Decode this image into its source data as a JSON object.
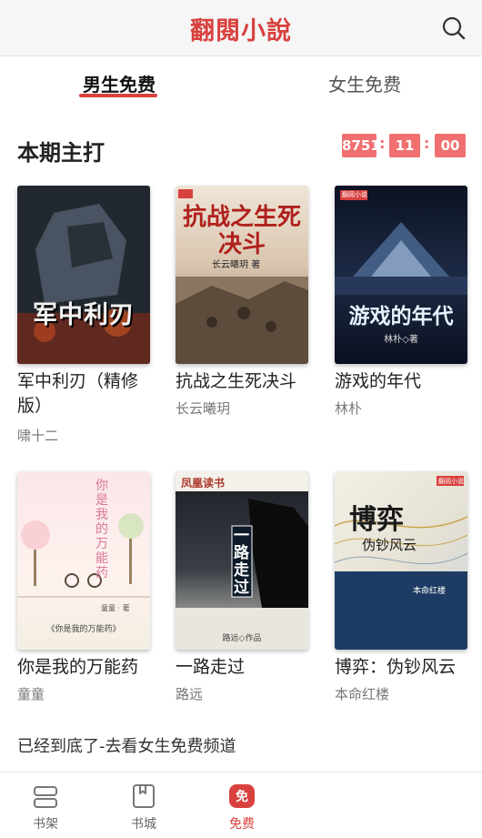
{
  "header": {
    "title": "翻閱小說",
    "search_icon": "search-icon"
  },
  "tabs": [
    {
      "label": "男生免费",
      "active": true
    },
    {
      "label": "女生免费",
      "active": false
    }
  ],
  "section": {
    "title": "本期主打",
    "countdown": {
      "hours": "8751",
      "minutes": "11",
      "seconds": "00"
    }
  },
  "books": [
    {
      "title": "军中利刃（精修版）",
      "author": "啸十二",
      "cover_text": "军中利刃"
    },
    {
      "title": "抗战之生死决斗",
      "author": "长云曦玥",
      "cover_text": "抗战之生死决斗",
      "cover_author": "长云曦玥 著"
    },
    {
      "title": "游戏的年代",
      "author": "林朴",
      "cover_text": "游戏的年代",
      "cover_author": "林朴◇著",
      "cover_brand": "翻阅小说"
    },
    {
      "title": "你是我的万能药",
      "author": "童童",
      "cover_text": "你是我的万能药",
      "cover_author": "童童 · 著",
      "cover_subtitle": "《你是我的万能药》"
    },
    {
      "title": "一路走过",
      "author": "路远",
      "cover_text": "一路走过",
      "cover_author": "路远◇作品",
      "cover_brand": "凤凰读书"
    },
    {
      "title": "博弈：伪钞风云",
      "author": "本命红楼",
      "cover_text": "博弈",
      "cover_subtitle": "伪钞风云",
      "cover_author": "本命红楼",
      "cover_brand": "翻阅小说"
    }
  ],
  "bottom_note": "已经到底了-去看女生免费频道",
  "tabbar": [
    {
      "label": "书架",
      "icon": "bookshelf-icon",
      "active": false
    },
    {
      "label": "书城",
      "icon": "bookstore-icon",
      "active": false
    },
    {
      "label": "免费",
      "icon": "free-icon",
      "icon_text": "免",
      "active": true
    }
  ],
  "colors": {
    "accent": "#d8413e",
    "timer": "#f07070"
  }
}
